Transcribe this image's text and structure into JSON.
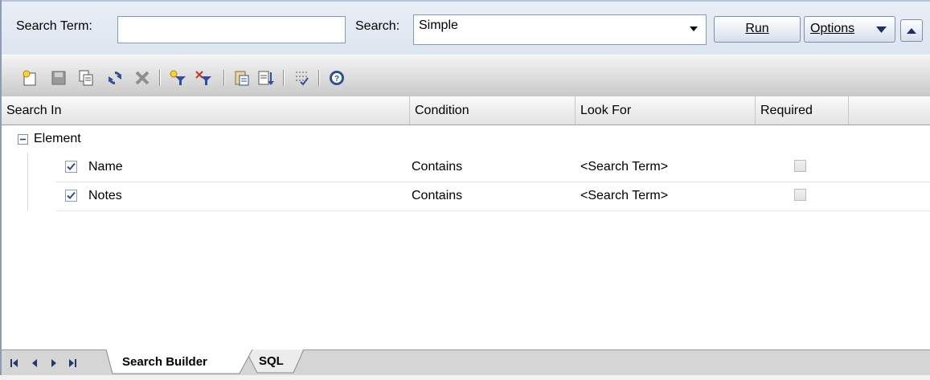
{
  "search": {
    "term_label": "Search Term:",
    "term_value": "",
    "type_label": "Search:",
    "type_value": "Simple",
    "run_label": "Run",
    "options_label": "Options"
  },
  "toolbar": {
    "icons": [
      "new-search-icon",
      "save-icon",
      "copy-icon",
      "refresh-icon",
      "delete-icon",
      "add-filter-icon",
      "remove-filter-icon",
      "paste-icon",
      "export-icon",
      "checklist-icon",
      "help-icon"
    ]
  },
  "columns": {
    "search_in": "Search In",
    "condition": "Condition",
    "look_for": "Look For",
    "required": "Required"
  },
  "tree": {
    "group": "Element",
    "rows": [
      {
        "checked": true,
        "name": "Name",
        "condition": "Contains",
        "look_for": "<Search Term>",
        "required": false
      },
      {
        "checked": true,
        "name": "Notes",
        "condition": "Contains",
        "look_for": "<Search Term>",
        "required": false
      }
    ]
  },
  "tabs": {
    "active": "Search Builder",
    "other": "SQL"
  }
}
